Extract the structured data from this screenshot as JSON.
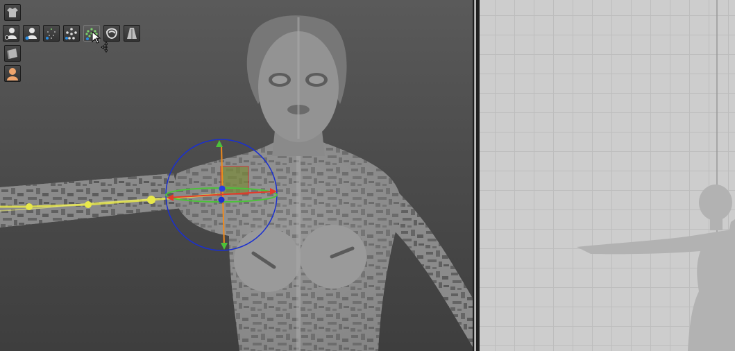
{
  "app": {
    "theme": {
      "viewport_bg": "#4c4c4c",
      "pattern_view_bg": "#cdcdcd",
      "grid": "#bdbdbd",
      "gizmo_x": "#e23b2a",
      "gizmo_y": "#4cc23a",
      "gizmo_rotate": "#1a2fd0",
      "bone": "#e8e84a"
    }
  },
  "toolbar": {
    "rows": [
      [
        {
          "icon": "garment-icon",
          "state": "normal"
        }
      ],
      [
        {
          "icon": "avatar-show-icon",
          "state": "normal"
        },
        {
          "icon": "avatar-select-icon",
          "state": "normal"
        },
        {
          "icon": "arrangement-points-icon",
          "state": "normal"
        },
        {
          "icon": "skeleton-joints-icon",
          "state": "normal"
        },
        {
          "icon": "xray-joints-icon",
          "state": "active"
        },
        {
          "icon": "avatar-texture-icon",
          "state": "normal"
        },
        {
          "icon": "avatar-measure-icon",
          "state": "normal"
        }
      ],
      [
        {
          "icon": "fabric-icon",
          "state": "normal"
        }
      ],
      [
        {
          "icon": "avatar-skin-icon",
          "state": "normal"
        }
      ]
    ]
  },
  "cursor": {
    "icon": "move-cursor-icon"
  }
}
